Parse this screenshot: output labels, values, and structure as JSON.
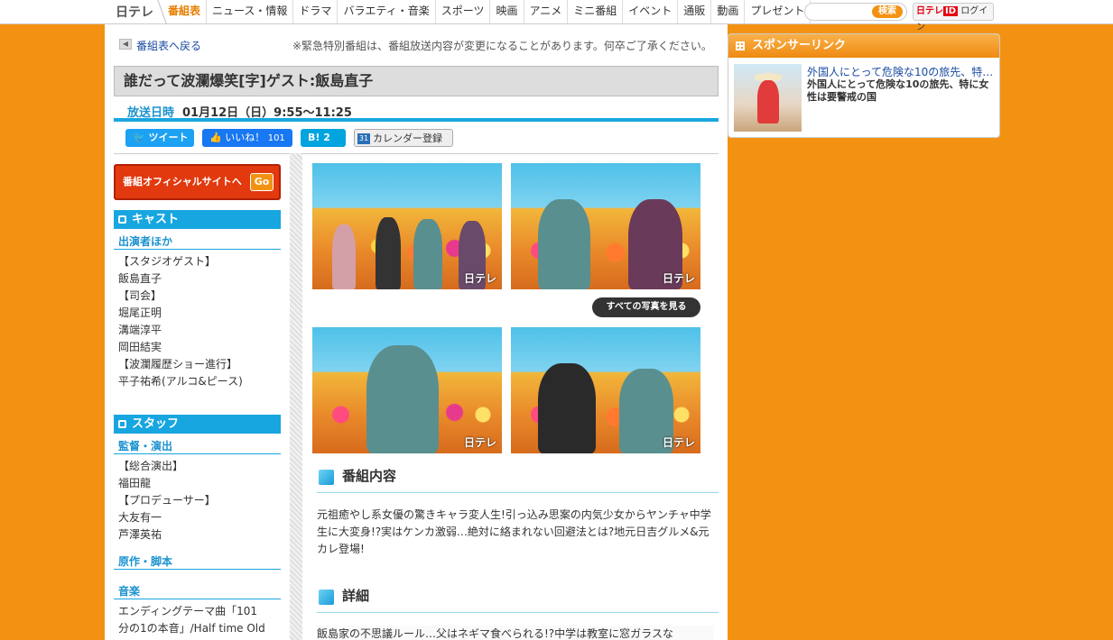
{
  "header": {
    "logo": "日テレ",
    "nav": [
      "番組表",
      "ニュース・情報",
      "ドラマ",
      "バラエティ・音楽",
      "スポーツ",
      "映画",
      "アニメ",
      "ミニ番組",
      "イベント",
      "通販",
      "動画",
      "プレゼント"
    ],
    "search_button": "検索",
    "login_logo": "日テレ",
    "login_id": "ID",
    "login_label": "ログイン"
  },
  "page": {
    "back_label": "番組表へ戻る",
    "notice": "※緊急特別番組は、番組放送内容が変更になることがあります。何卒ご了承ください。",
    "title": "誰だって波瀾爆笑[字]ゲスト:飯島直子",
    "airtime_label": "放送日時",
    "airtime_value": "01月12日（日）9:55〜11:25"
  },
  "social": {
    "tweet": "ツイート",
    "like": "いいね！",
    "like_count": "101",
    "hatena": "B!",
    "hatena_count": "2",
    "calendar": "カレンダー登録",
    "calendar_icon": "31"
  },
  "sidebar": {
    "official_site": "番組オフィシャルサイトへ",
    "go": "Go",
    "cast_heading": "キャスト",
    "cast_sub": "出演者ほか",
    "cast_list": [
      "【スタジオゲスト】",
      "飯島直子",
      "【司会】",
      "堀尾正明",
      "溝端淳平",
      "岡田結実",
      "【波瀾履歴ショー進行】",
      "平子祐希(アルコ&ピース)"
    ],
    "staff_heading": "スタッフ",
    "staff_sub": "監督・演出",
    "staff_list": [
      "【総合演出】",
      "福田龍",
      "【プロデューサー】",
      "大友有一",
      "芦澤英祐"
    ],
    "original_sub": "原作・脚本",
    "music_sub": "音楽",
    "music_list": [
      "エンディングテーマ曲「101",
      "分の1の本音」/Half time Old"
    ]
  },
  "photos": {
    "watermark": "日テレ",
    "view_all": "すべての写真を見る"
  },
  "sections": {
    "content_heading": "番組内容",
    "content_body": "元祖癒やし系女優の驚きキャラ変人生!引っ込み思案の内気少女からヤンチャ中学生に大変身!?実はケンカ激弱…絶対に絡まれない回避法とは?地元日吉グルメ&元カレ登場!",
    "detail_heading": "詳細",
    "detail_body": "飯島家の不思議ルール…父はネギマ食べられる!?中学は教室に窓ガラスな"
  },
  "sponsor": {
    "heading": "スポンサーリンク",
    "title": "外国人にとって危険な10の旅先、特…",
    "desc": "外国人にとって危険な10の旅先、特に女性は要警戒の国"
  },
  "colors": {
    "page_bg": "#f39212",
    "accent_blue": "#18a6e0",
    "accent_orange": "#ef8a10"
  }
}
